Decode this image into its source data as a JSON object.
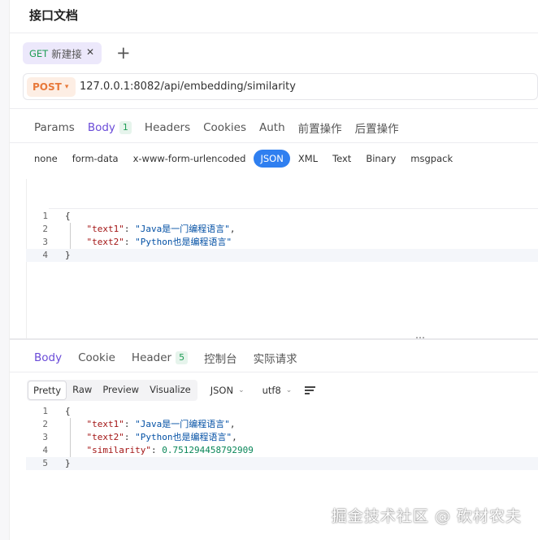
{
  "page": {
    "title": "接口文档"
  },
  "request_tab": {
    "method": "GET",
    "name": "新建接",
    "close": "✕",
    "add": "+"
  },
  "url_bar": {
    "method": "POST",
    "method_caret": "▾",
    "url": "127.0.0.1:8082/api/embedding/similarity"
  },
  "request_tabs": [
    {
      "label": "Params"
    },
    {
      "label": "Body",
      "badge": "1",
      "active": true
    },
    {
      "label": "Headers"
    },
    {
      "label": "Cookies"
    },
    {
      "label": "Auth"
    },
    {
      "label": "前置操作"
    },
    {
      "label": "后置操作"
    }
  ],
  "body_types": [
    {
      "label": "none"
    },
    {
      "label": "form-data"
    },
    {
      "label": "x-www-form-urlencoded"
    },
    {
      "label": "JSON",
      "active": true
    },
    {
      "label": "XML"
    },
    {
      "label": "Text"
    },
    {
      "label": "Binary"
    },
    {
      "label": "msgpack"
    }
  ],
  "request_body": {
    "lines": [
      {
        "n": "1",
        "open": "{"
      },
      {
        "n": "2",
        "key": "\"text1\"",
        "value": "\"Java是一门编程语言\"",
        "comma": ","
      },
      {
        "n": "3",
        "key": "\"text2\"",
        "value": "\"Python也是编程语言\"",
        "comma": ""
      },
      {
        "n": "4",
        "close": "}"
      }
    ]
  },
  "splitter": {
    "grip": "⋯"
  },
  "response_tabs": [
    {
      "label": "Body",
      "active": true
    },
    {
      "label": "Cookie"
    },
    {
      "label": "Header",
      "badge": "5"
    },
    {
      "label": "控制台"
    },
    {
      "label": "实际请求"
    }
  ],
  "response_format": {
    "views": [
      {
        "label": "Pretty",
        "active": true
      },
      {
        "label": "Raw"
      },
      {
        "label": "Preview"
      },
      {
        "label": "Visualize"
      }
    ],
    "format_select": "JSON",
    "encoding_select": "utf8",
    "caret": "⌄"
  },
  "response_body": {
    "lines": [
      {
        "n": "1",
        "open": "{"
      },
      {
        "n": "2",
        "key": "\"text1\"",
        "value": "\"Java是一门编程语言\"",
        "comma": ",",
        "type": "string"
      },
      {
        "n": "3",
        "key": "\"text2\"",
        "value": "\"Python也是编程语言\"",
        "comma": ",",
        "type": "string"
      },
      {
        "n": "4",
        "key": "\"similarity\"",
        "value": "0.751294458792909",
        "comma": "",
        "type": "number"
      },
      {
        "n": "5",
        "close": "}"
      }
    ]
  },
  "watermark": "掘金技术社区 @ 砍材农夫",
  "colors": {
    "accent": "#6a4bd8",
    "json_active": "#2f7ff0",
    "post": "#e8793a",
    "get": "#1f9d55"
  }
}
